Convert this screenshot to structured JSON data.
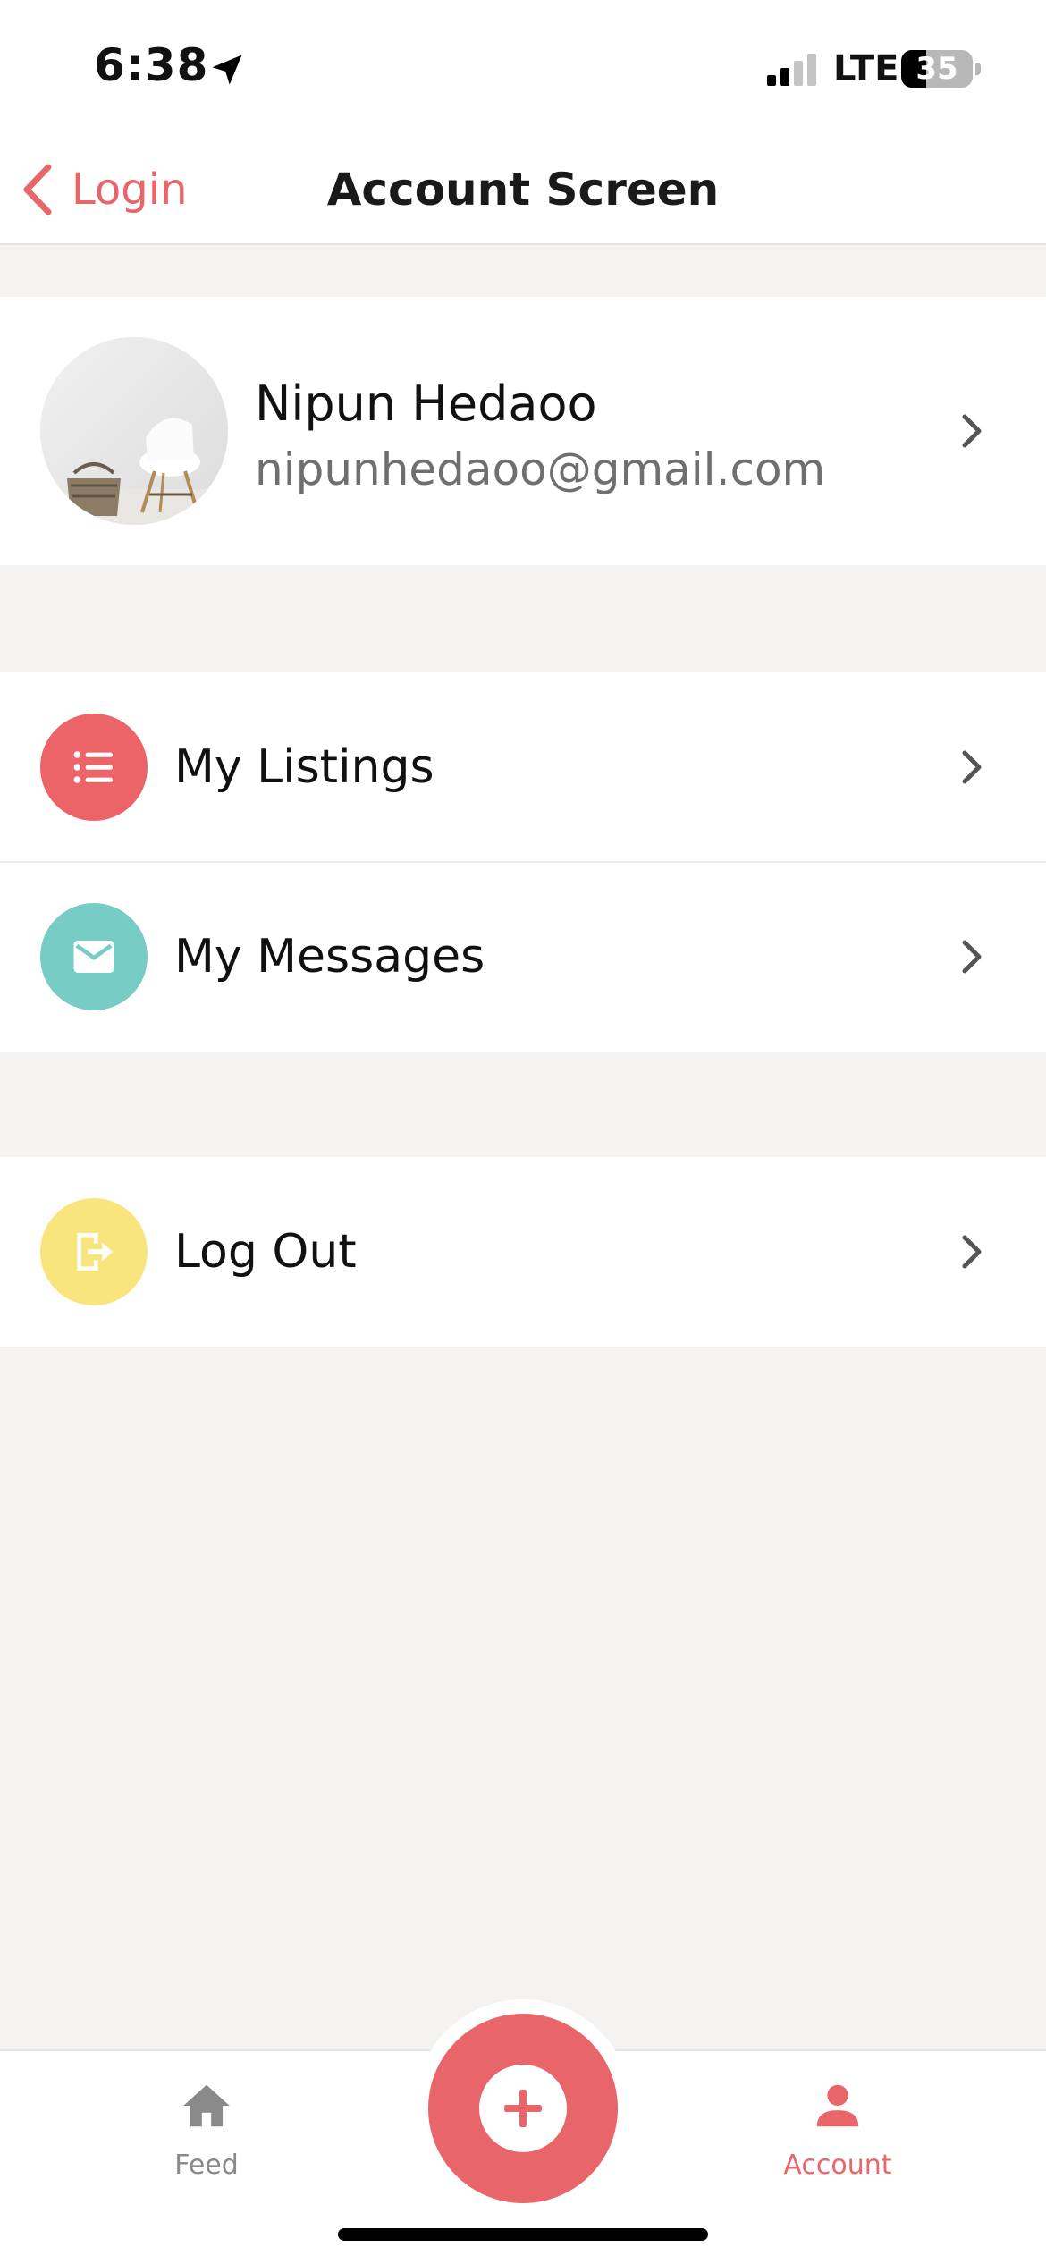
{
  "status_bar": {
    "time": "6:38",
    "network": "LTE",
    "battery_level": "35",
    "battery_fraction": 0.35,
    "signal_bars_active": 2,
    "signal_bars_total": 4
  },
  "nav": {
    "back_label": "Login",
    "title": "Account Screen"
  },
  "profile": {
    "name": "Nipun Hedaoo",
    "email": "nipunhedaoo@gmail.com",
    "avatar_icon": "avatar-photo"
  },
  "menu": {
    "items": [
      {
        "label": "My Listings",
        "icon": "list-icon",
        "color": "#ec6468"
      },
      {
        "label": "My Messages",
        "icon": "mail-icon",
        "color": "#77cdc5"
      }
    ]
  },
  "logout": {
    "label": "Log Out",
    "icon": "logout-icon",
    "color": "#f8e57d"
  },
  "tabs": {
    "feed_label": "Feed",
    "account_label": "Account",
    "active": "Account"
  },
  "colors": {
    "accent": "#e8666a",
    "background": "#f4f3f2",
    "inactive": "#8a8a8a"
  }
}
